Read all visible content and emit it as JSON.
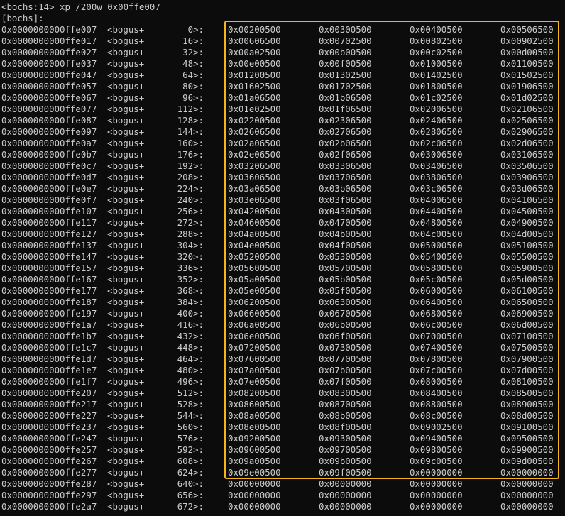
{
  "prompt_line": "<bochs:14> xp /200w 0x00ffe007",
  "label_line": "[bochs]:",
  "highlight_color": "#f5b41a",
  "rows": [
    {
      "addr": "0x0000000000ffe007",
      "sym": "<bogus+",
      "off": "0>:",
      "w": [
        "0x00200500",
        "0x00300500",
        "0x00400500",
        "0x00506500"
      ]
    },
    {
      "addr": "0x0000000000ffe017",
      "sym": "<bogus+",
      "off": "16>:",
      "w": [
        "0x00606500",
        "0x00702500",
        "0x00802500",
        "0x00902500"
      ]
    },
    {
      "addr": "0x0000000000ffe027",
      "sym": "<bogus+",
      "off": "32>:",
      "w": [
        "0x00a02500",
        "0x00b00500",
        "0x00c02500",
        "0x00d00500"
      ]
    },
    {
      "addr": "0x0000000000ffe037",
      "sym": "<bogus+",
      "off": "48>:",
      "w": [
        "0x00e00500",
        "0x00f00500",
        "0x01000500",
        "0x01100500"
      ]
    },
    {
      "addr": "0x0000000000ffe047",
      "sym": "<bogus+",
      "off": "64>:",
      "w": [
        "0x01200500",
        "0x01302500",
        "0x01402500",
        "0x01502500"
      ]
    },
    {
      "addr": "0x0000000000ffe057",
      "sym": "<bogus+",
      "off": "80>:",
      "w": [
        "0x01602500",
        "0x01702500",
        "0x01800500",
        "0x01906500"
      ]
    },
    {
      "addr": "0x0000000000ffe067",
      "sym": "<bogus+",
      "off": "96>:",
      "w": [
        "0x01a06500",
        "0x01b06500",
        "0x01c02500",
        "0x01d02500"
      ]
    },
    {
      "addr": "0x0000000000ffe077",
      "sym": "<bogus+",
      "off": "112>:",
      "w": [
        "0x01e02500",
        "0x01f06500",
        "0x02006500",
        "0x02106500"
      ]
    },
    {
      "addr": "0x0000000000ffe087",
      "sym": "<bogus+",
      "off": "128>:",
      "w": [
        "0x02200500",
        "0x02306500",
        "0x02406500",
        "0x02506500"
      ]
    },
    {
      "addr": "0x0000000000ffe097",
      "sym": "<bogus+",
      "off": "144>:",
      "w": [
        "0x02606500",
        "0x02706500",
        "0x02806500",
        "0x02906500"
      ]
    },
    {
      "addr": "0x0000000000ffe0a7",
      "sym": "<bogus+",
      "off": "160>:",
      "w": [
        "0x02a06500",
        "0x02b06500",
        "0x02c06500",
        "0x02d06500"
      ]
    },
    {
      "addr": "0x0000000000ffe0b7",
      "sym": "<bogus+",
      "off": "176>:",
      "w": [
        "0x02e06500",
        "0x02f06500",
        "0x03006500",
        "0x03106500"
      ]
    },
    {
      "addr": "0x0000000000ffe0c7",
      "sym": "<bogus+",
      "off": "192>:",
      "w": [
        "0x03206500",
        "0x03306500",
        "0x03406500",
        "0x03506500"
      ]
    },
    {
      "addr": "0x0000000000ffe0d7",
      "sym": "<bogus+",
      "off": "208>:",
      "w": [
        "0x03606500",
        "0x03706500",
        "0x03806500",
        "0x03906500"
      ]
    },
    {
      "addr": "0x0000000000ffe0e7",
      "sym": "<bogus+",
      "off": "224>:",
      "w": [
        "0x03a06500",
        "0x03b06500",
        "0x03c06500",
        "0x03d06500"
      ]
    },
    {
      "addr": "0x0000000000ffe0f7",
      "sym": "<bogus+",
      "off": "240>:",
      "w": [
        "0x03e06500",
        "0x03f06500",
        "0x04006500",
        "0x04106500"
      ]
    },
    {
      "addr": "0x0000000000ffe107",
      "sym": "<bogus+",
      "off": "256>:",
      "w": [
        "0x04200500",
        "0x04300500",
        "0x04400500",
        "0x04500500"
      ]
    },
    {
      "addr": "0x0000000000ffe117",
      "sym": "<bogus+",
      "off": "272>:",
      "w": [
        "0x04600500",
        "0x04700500",
        "0x04800500",
        "0x04900500"
      ]
    },
    {
      "addr": "0x0000000000ffe127",
      "sym": "<bogus+",
      "off": "288>:",
      "w": [
        "0x04a00500",
        "0x04b00500",
        "0x04c00500",
        "0x04d00500"
      ]
    },
    {
      "addr": "0x0000000000ffe137",
      "sym": "<bogus+",
      "off": "304>:",
      "w": [
        "0x04e00500",
        "0x04f00500",
        "0x05000500",
        "0x05100500"
      ]
    },
    {
      "addr": "0x0000000000ffe147",
      "sym": "<bogus+",
      "off": "320>:",
      "w": [
        "0x05200500",
        "0x05300500",
        "0x05400500",
        "0x05500500"
      ]
    },
    {
      "addr": "0x0000000000ffe157",
      "sym": "<bogus+",
      "off": "336>:",
      "w": [
        "0x05600500",
        "0x05700500",
        "0x05800500",
        "0x05900500"
      ]
    },
    {
      "addr": "0x0000000000ffe167",
      "sym": "<bogus+",
      "off": "352>:",
      "w": [
        "0x05a00500",
        "0x05b00500",
        "0x05c00500",
        "0x05d00500"
      ]
    },
    {
      "addr": "0x0000000000ffe177",
      "sym": "<bogus+",
      "off": "368>:",
      "w": [
        "0x05e00500",
        "0x05f00500",
        "0x06000500",
        "0x06100500"
      ]
    },
    {
      "addr": "0x0000000000ffe187",
      "sym": "<bogus+",
      "off": "384>:",
      "w": [
        "0x06200500",
        "0x06300500",
        "0x06400500",
        "0x06500500"
      ]
    },
    {
      "addr": "0x0000000000ffe197",
      "sym": "<bogus+",
      "off": "400>:",
      "w": [
        "0x06600500",
        "0x06700500",
        "0x06800500",
        "0x06900500"
      ]
    },
    {
      "addr": "0x0000000000ffe1a7",
      "sym": "<bogus+",
      "off": "416>:",
      "w": [
        "0x06a00500",
        "0x06b00500",
        "0x06c00500",
        "0x06d00500"
      ]
    },
    {
      "addr": "0x0000000000ffe1b7",
      "sym": "<bogus+",
      "off": "432>:",
      "w": [
        "0x06e00500",
        "0x06f00500",
        "0x07000500",
        "0x07100500"
      ]
    },
    {
      "addr": "0x0000000000ffe1c7",
      "sym": "<bogus+",
      "off": "448>:",
      "w": [
        "0x07200500",
        "0x07300500",
        "0x07400500",
        "0x07500500"
      ]
    },
    {
      "addr": "0x0000000000ffe1d7",
      "sym": "<bogus+",
      "off": "464>:",
      "w": [
        "0x07600500",
        "0x07700500",
        "0x07800500",
        "0x07900500"
      ]
    },
    {
      "addr": "0x0000000000ffe1e7",
      "sym": "<bogus+",
      "off": "480>:",
      "w": [
        "0x07a00500",
        "0x07b00500",
        "0x07c00500",
        "0x07d00500"
      ]
    },
    {
      "addr": "0x0000000000ffe1f7",
      "sym": "<bogus+",
      "off": "496>:",
      "w": [
        "0x07e00500",
        "0x07f00500",
        "0x08000500",
        "0x08100500"
      ]
    },
    {
      "addr": "0x0000000000ffe207",
      "sym": "<bogus+",
      "off": "512>:",
      "w": [
        "0x08200500",
        "0x08300500",
        "0x08400500",
        "0x08500500"
      ]
    },
    {
      "addr": "0x0000000000ffe217",
      "sym": "<bogus+",
      "off": "528>:",
      "w": [
        "0x08600500",
        "0x08700500",
        "0x08800500",
        "0x08900500"
      ]
    },
    {
      "addr": "0x0000000000ffe227",
      "sym": "<bogus+",
      "off": "544>:",
      "w": [
        "0x08a00500",
        "0x08b00500",
        "0x08c00500",
        "0x08d00500"
      ]
    },
    {
      "addr": "0x0000000000ffe237",
      "sym": "<bogus+",
      "off": "560>:",
      "w": [
        "0x08e00500",
        "0x08f00500",
        "0x09002500",
        "0x09100500"
      ]
    },
    {
      "addr": "0x0000000000ffe247",
      "sym": "<bogus+",
      "off": "576>:",
      "w": [
        "0x09200500",
        "0x09300500",
        "0x09400500",
        "0x09500500"
      ]
    },
    {
      "addr": "0x0000000000ffe257",
      "sym": "<bogus+",
      "off": "592>:",
      "w": [
        "0x09600500",
        "0x09700500",
        "0x09800500",
        "0x09900500"
      ]
    },
    {
      "addr": "0x0000000000ffe267",
      "sym": "<bogus+",
      "off": "608>:",
      "w": [
        "0x09a00500",
        "0x09b00500",
        "0x09c00500",
        "0x09d00500"
      ]
    },
    {
      "addr": "0x0000000000ffe277",
      "sym": "<bogus+",
      "off": "624>:",
      "w": [
        "0x09e00500",
        "0x09f00500",
        "0x00000000",
        "0x00000000"
      ]
    },
    {
      "addr": "0x0000000000ffe287",
      "sym": "<bogus+",
      "off": "640>:",
      "w": [
        "0x00000000",
        "0x00000000",
        "0x00000000",
        "0x00000000"
      ]
    },
    {
      "addr": "0x0000000000ffe297",
      "sym": "<bogus+",
      "off": "656>:",
      "w": [
        "0x00000000",
        "0x00000000",
        "0x00000000",
        "0x00000000"
      ]
    },
    {
      "addr": "0x0000000000ffe2a7",
      "sym": "<bogus+",
      "off": "672>:",
      "w": [
        "0x00000000",
        "0x00000000",
        "0x00000000",
        "0x00000000"
      ]
    }
  ]
}
